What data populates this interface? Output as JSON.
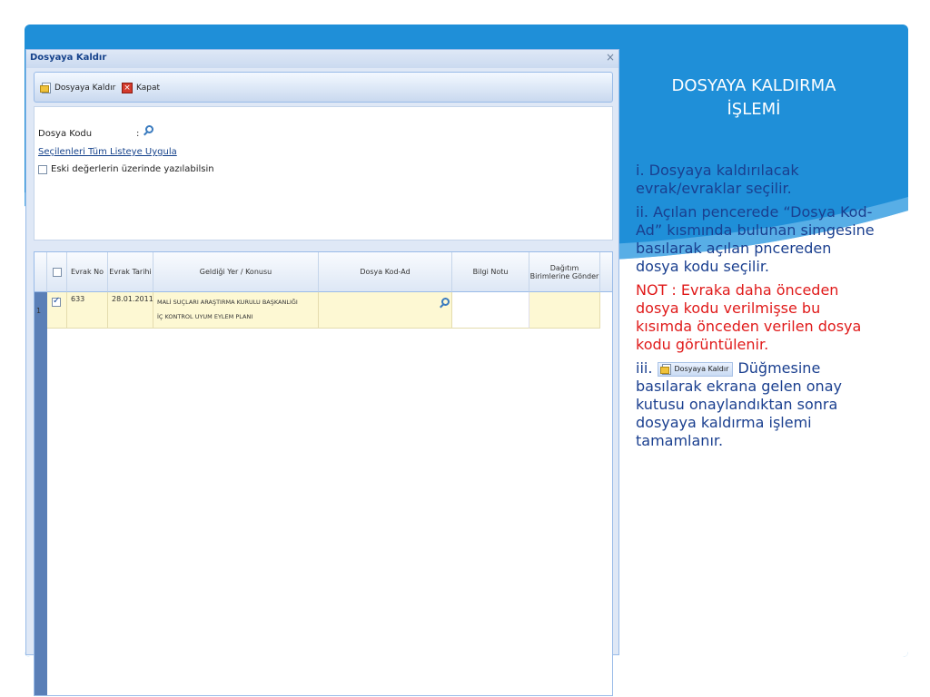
{
  "colors": {
    "band": "#1f8fd8",
    "note_red": "#e01a1a",
    "text_blue": "#1a3f8f"
  },
  "window": {
    "title": "Dosyaya Kaldır",
    "close_glyph": "×",
    "toolbar": {
      "attach_label": "Dosyaya Kaldır",
      "close_label": "Kapat"
    },
    "form": {
      "dosya_kodu_label": "Dosya Kodu",
      "colon": ":",
      "apply_all_link": "Seçilenleri Tüm Listeye Uygula",
      "overwrite_label": "Eski değerlerin üzerinde yazılabilsin"
    },
    "grid": {
      "columns": [
        "Evrak No",
        "Evrak Tarihi",
        "Geldiği Yer / Konusu",
        "Dosya Kod-Ad",
        "Bilgi Notu",
        "Dağıtım Birimlerine Gönder"
      ],
      "rows": [
        {
          "num": "1",
          "checked": true,
          "evrak_no": "633",
          "evrak_tarihi": "28.01.2011",
          "konu_line1": "MALİ SUÇLARI ARAŞTIRMA KURULU BAŞKANLIĞI",
          "konu_line2": "İÇ KONTROL UYUM EYLEM PLANI",
          "dosya_kod_ad": "",
          "bilgi_notu": "",
          "dagitim": ""
        }
      ]
    }
  },
  "panel": {
    "title_line1": "DOSYAYA KALDIRMA",
    "title_line2": "İŞLEMİ",
    "step1": "i. Dosyaya kaldırılacak evrak/evraklar seçilir.",
    "step2": "ii. Açılan pencerede “Dosya Kod-Ad” kısmında bulunan  simgesine basılarak açılan pncereden dosya kodu seçilir.",
    "note": "NOT : Evraka daha önceden dosya kodu verilmişse bu kısımda önceden      verilen dosya kodu görüntülenir.",
    "step3_prefix": "iii.",
    "step3_button": "Dosyaya Kaldır",
    "step3_suffix": "Düğmesine basılarak ekrana gelen onay kutusu onaylandıktan sonra dosyaya kaldırma işlemi tamamlanır."
  }
}
